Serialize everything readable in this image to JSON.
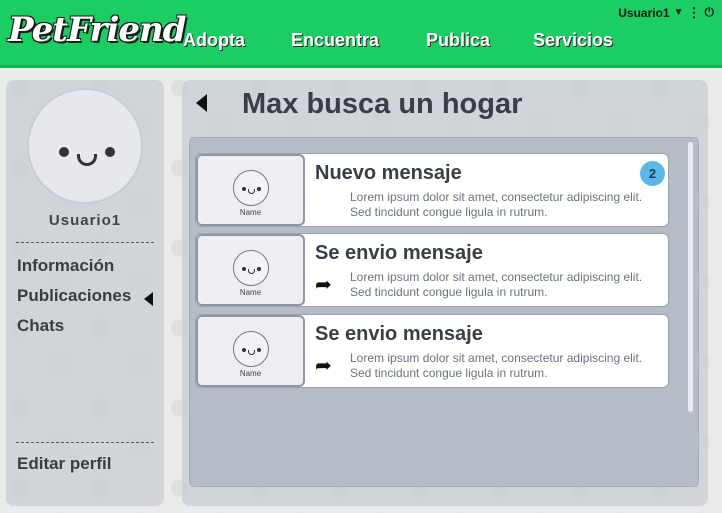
{
  "header": {
    "logo": "PetFriend",
    "nav": [
      "Adopta",
      "Encuentra",
      "Publica",
      "Servicios"
    ],
    "user_label": "Usuario1",
    "caret_icon": "▼",
    "kebab_icon": "⋮",
    "power_icon": "⏻",
    "brand_color": "#1ccd63"
  },
  "sidebar": {
    "username": "Usuario1",
    "menu": [
      "Información",
      "Publicaciones",
      "Chats"
    ],
    "active_item": "Publicaciones",
    "edit_profile": "Editar perfil"
  },
  "main": {
    "title": "Max busca un hogar",
    "cards": [
      {
        "title": "Nuevo mensaje",
        "thumb_name": "Name",
        "preview_line1": "Lorem ipsum dolor sit amet, consectetur adipiscing elit.",
        "preview_line2": "Sed tincidunt congue ligula in rutrum.",
        "badge": "2",
        "status_icon": ""
      },
      {
        "title": "Se envio mensaje",
        "thumb_name": "Name",
        "preview_line1": "Lorem ipsum dolor sit amet, consectetur adipiscing elit.",
        "preview_line2": "Sed tincidunt congue ligula in rutrum.",
        "badge": "",
        "status_icon": "➦"
      },
      {
        "title": "Se envio mensaje",
        "thumb_name": "Name",
        "preview_line1": "Lorem ipsum dolor sit amet, consectetur adipiscing elit.",
        "preview_line2": "Sed tincidunt congue ligula in rutrum.",
        "badge": "",
        "status_icon": "➦"
      }
    ]
  }
}
